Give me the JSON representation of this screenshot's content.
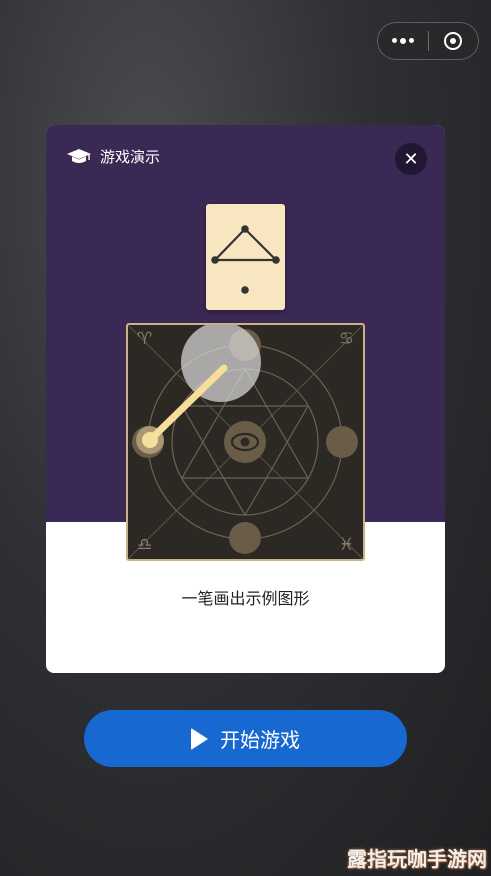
{
  "capsule": {
    "menu_icon": "more-dots-icon",
    "close_icon": "target-icon"
  },
  "modal": {
    "title": "游戏演示",
    "title_icon": "graduation-cap-icon",
    "close_label": "✕",
    "caption": "一笔画出示例图形",
    "header_color": "#3a2855"
  },
  "board": {
    "zodiac_top_left": "♈",
    "zodiac_top_right": "♋",
    "zodiac_bottom_left": "♎",
    "zodiac_bottom_right": "♓"
  },
  "start_button": {
    "label": "开始游戏",
    "color": "#1769d1"
  },
  "watermark": "露指玩咖手游网"
}
